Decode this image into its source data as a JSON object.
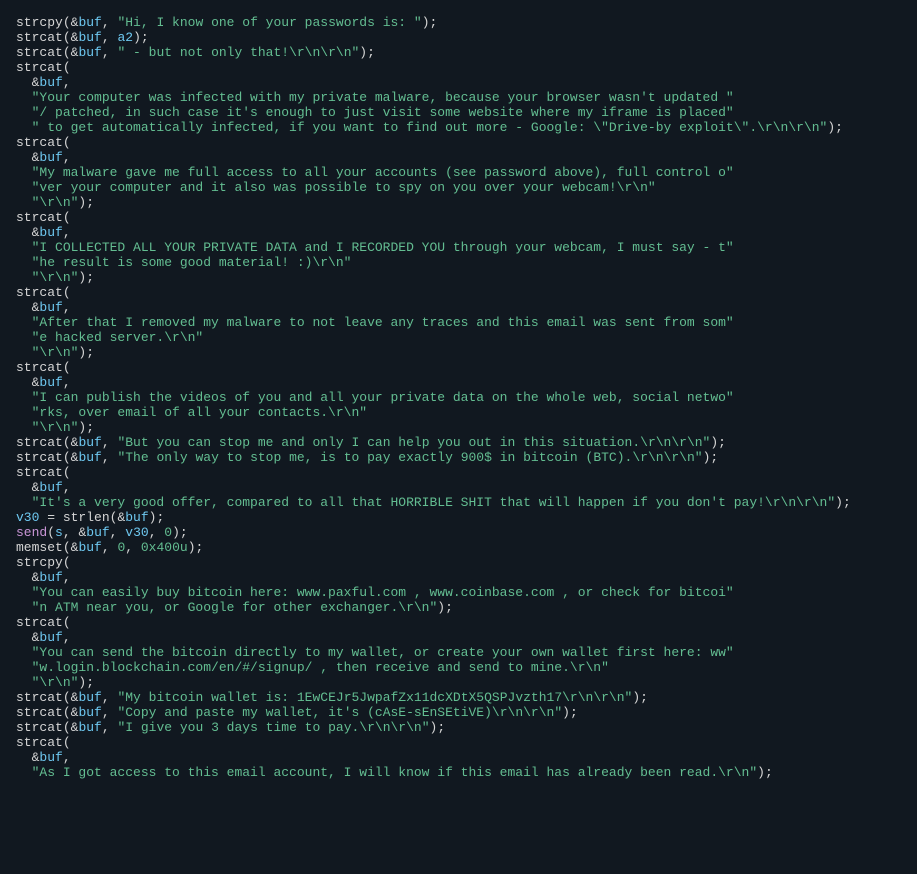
{
  "colors": {
    "background": "#111820",
    "default": "#d5d5d5",
    "variable": "#6ec8f0",
    "string": "#63bd91",
    "number": "#63bd91",
    "keyword": "#c995d6"
  },
  "code": {
    "lines": [
      [
        {
          "t": "fn",
          "v": "strcpy"
        },
        {
          "t": "op",
          "v": "("
        },
        {
          "t": "amp",
          "v": "&"
        },
        {
          "t": "var",
          "v": "buf"
        },
        {
          "t": "op",
          "v": ", "
        },
        {
          "t": "str",
          "v": "\"Hi, I know one of your passwords is: \""
        },
        {
          "t": "op",
          "v": ");"
        }
      ],
      [
        {
          "t": "fn",
          "v": "strcat"
        },
        {
          "t": "op",
          "v": "("
        },
        {
          "t": "amp",
          "v": "&"
        },
        {
          "t": "var",
          "v": "buf"
        },
        {
          "t": "op",
          "v": ", "
        },
        {
          "t": "var",
          "v": "a2"
        },
        {
          "t": "op",
          "v": ");"
        }
      ],
      [
        {
          "t": "fn",
          "v": "strcat"
        },
        {
          "t": "op",
          "v": "("
        },
        {
          "t": "amp",
          "v": "&"
        },
        {
          "t": "var",
          "v": "buf"
        },
        {
          "t": "op",
          "v": ", "
        },
        {
          "t": "str",
          "v": "\" - but not only that!\\r\\n\\r\\n\""
        },
        {
          "t": "op",
          "v": ");"
        }
      ],
      [
        {
          "t": "fn",
          "v": "strcat"
        },
        {
          "t": "op",
          "v": "("
        }
      ],
      [
        {
          "t": "pad",
          "v": "  "
        },
        {
          "t": "amp",
          "v": "&"
        },
        {
          "t": "var",
          "v": "buf"
        },
        {
          "t": "op",
          "v": ","
        }
      ],
      [
        {
          "t": "pad",
          "v": "  "
        },
        {
          "t": "str",
          "v": "\"Your computer was infected with my private malware, because your browser wasn't updated \""
        }
      ],
      [
        {
          "t": "pad",
          "v": "  "
        },
        {
          "t": "str",
          "v": "\"/ patched, in such case it's enough to just visit some website where my iframe is placed\""
        }
      ],
      [
        {
          "t": "pad",
          "v": "  "
        },
        {
          "t": "str",
          "v": "\" to get automatically infected, if you want to find out more - Google: \\\"Drive-by exploit\\\".\\r\\n\\r\\n\""
        },
        {
          "t": "op",
          "v": ");"
        }
      ],
      [
        {
          "t": "fn",
          "v": "strcat"
        },
        {
          "t": "op",
          "v": "("
        }
      ],
      [
        {
          "t": "pad",
          "v": "  "
        },
        {
          "t": "amp",
          "v": "&"
        },
        {
          "t": "var",
          "v": "buf"
        },
        {
          "t": "op",
          "v": ","
        }
      ],
      [
        {
          "t": "pad",
          "v": "  "
        },
        {
          "t": "str",
          "v": "\"My malware gave me full access to all your accounts (see password above), full control o\""
        }
      ],
      [
        {
          "t": "pad",
          "v": "  "
        },
        {
          "t": "str",
          "v": "\"ver your computer and it also was possible to spy on you over your webcam!\\r\\n\""
        }
      ],
      [
        {
          "t": "pad",
          "v": "  "
        },
        {
          "t": "str",
          "v": "\"\\r\\n\""
        },
        {
          "t": "op",
          "v": ");"
        }
      ],
      [
        {
          "t": "fn",
          "v": "strcat"
        },
        {
          "t": "op",
          "v": "("
        }
      ],
      [
        {
          "t": "pad",
          "v": "  "
        },
        {
          "t": "amp",
          "v": "&"
        },
        {
          "t": "var",
          "v": "buf"
        },
        {
          "t": "op",
          "v": ","
        }
      ],
      [
        {
          "t": "pad",
          "v": "  "
        },
        {
          "t": "str",
          "v": "\"I COLLECTED ALL YOUR PRIVATE DATA and I RECORDED YOU through your webcam, I must say - t\""
        }
      ],
      [
        {
          "t": "pad",
          "v": "  "
        },
        {
          "t": "str",
          "v": "\"he result is some good material! :)\\r\\n\""
        }
      ],
      [
        {
          "t": "pad",
          "v": "  "
        },
        {
          "t": "str",
          "v": "\"\\r\\n\""
        },
        {
          "t": "op",
          "v": ");"
        }
      ],
      [
        {
          "t": "fn",
          "v": "strcat"
        },
        {
          "t": "op",
          "v": "("
        }
      ],
      [
        {
          "t": "pad",
          "v": "  "
        },
        {
          "t": "amp",
          "v": "&"
        },
        {
          "t": "var",
          "v": "buf"
        },
        {
          "t": "op",
          "v": ","
        }
      ],
      [
        {
          "t": "pad",
          "v": "  "
        },
        {
          "t": "str",
          "v": "\"After that I removed my malware to not leave any traces and this email was sent from som\""
        }
      ],
      [
        {
          "t": "pad",
          "v": "  "
        },
        {
          "t": "str",
          "v": "\"e hacked server.\\r\\n\""
        }
      ],
      [
        {
          "t": "pad",
          "v": "  "
        },
        {
          "t": "str",
          "v": "\"\\r\\n\""
        },
        {
          "t": "op",
          "v": ");"
        }
      ],
      [
        {
          "t": "fn",
          "v": "strcat"
        },
        {
          "t": "op",
          "v": "("
        }
      ],
      [
        {
          "t": "pad",
          "v": "  "
        },
        {
          "t": "amp",
          "v": "&"
        },
        {
          "t": "var",
          "v": "buf"
        },
        {
          "t": "op",
          "v": ","
        }
      ],
      [
        {
          "t": "pad",
          "v": "  "
        },
        {
          "t": "str",
          "v": "\"I can publish the videos of you and all your private data on the whole web, social netwo\""
        }
      ],
      [
        {
          "t": "pad",
          "v": "  "
        },
        {
          "t": "str",
          "v": "\"rks, over email of all your contacts.\\r\\n\""
        }
      ],
      [
        {
          "t": "pad",
          "v": "  "
        },
        {
          "t": "str",
          "v": "\"\\r\\n\""
        },
        {
          "t": "op",
          "v": ");"
        }
      ],
      [
        {
          "t": "fn",
          "v": "strcat"
        },
        {
          "t": "op",
          "v": "("
        },
        {
          "t": "amp",
          "v": "&"
        },
        {
          "t": "var",
          "v": "buf"
        },
        {
          "t": "op",
          "v": ", "
        },
        {
          "t": "str",
          "v": "\"But you can stop me and only I can help you out in this situation.\\r\\n\\r\\n\""
        },
        {
          "t": "op",
          "v": ");"
        }
      ],
      [
        {
          "t": "fn",
          "v": "strcat"
        },
        {
          "t": "op",
          "v": "("
        },
        {
          "t": "amp",
          "v": "&"
        },
        {
          "t": "var",
          "v": "buf"
        },
        {
          "t": "op",
          "v": ", "
        },
        {
          "t": "str",
          "v": "\"The only way to stop me, is to pay exactly 900$ in bitcoin (BTC).\\r\\n\\r\\n\""
        },
        {
          "t": "op",
          "v": ");"
        }
      ],
      [
        {
          "t": "fn",
          "v": "strcat"
        },
        {
          "t": "op",
          "v": "("
        }
      ],
      [
        {
          "t": "pad",
          "v": "  "
        },
        {
          "t": "amp",
          "v": "&"
        },
        {
          "t": "var",
          "v": "buf"
        },
        {
          "t": "op",
          "v": ","
        }
      ],
      [
        {
          "t": "pad",
          "v": "  "
        },
        {
          "t": "str",
          "v": "\"It's a very good offer, compared to all that HORRIBLE SHIT that will happen if you don't pay!\\r\\n\\r\\n\""
        },
        {
          "t": "op",
          "v": ");"
        }
      ],
      [
        {
          "t": "var",
          "v": "v30"
        },
        {
          "t": "op",
          "v": " = "
        },
        {
          "t": "fn",
          "v": "strlen"
        },
        {
          "t": "op",
          "v": "("
        },
        {
          "t": "amp",
          "v": "&"
        },
        {
          "t": "var",
          "v": "buf"
        },
        {
          "t": "op",
          "v": ");"
        }
      ],
      [
        {
          "t": "kw",
          "v": "send"
        },
        {
          "t": "op",
          "v": "("
        },
        {
          "t": "var",
          "v": "s"
        },
        {
          "t": "op",
          "v": ", "
        },
        {
          "t": "amp",
          "v": "&"
        },
        {
          "t": "var",
          "v": "buf"
        },
        {
          "t": "op",
          "v": ", "
        },
        {
          "t": "var",
          "v": "v30"
        },
        {
          "t": "op",
          "v": ", "
        },
        {
          "t": "num",
          "v": "0"
        },
        {
          "t": "op",
          "v": ");"
        }
      ],
      [
        {
          "t": "fn",
          "v": "memset"
        },
        {
          "t": "op",
          "v": "("
        },
        {
          "t": "amp",
          "v": "&"
        },
        {
          "t": "var",
          "v": "buf"
        },
        {
          "t": "op",
          "v": ", "
        },
        {
          "t": "num",
          "v": "0"
        },
        {
          "t": "op",
          "v": ", "
        },
        {
          "t": "num",
          "v": "0x400u"
        },
        {
          "t": "op",
          "v": ");"
        }
      ],
      [
        {
          "t": "fn",
          "v": "strcpy"
        },
        {
          "t": "op",
          "v": "("
        }
      ],
      [
        {
          "t": "pad",
          "v": "  "
        },
        {
          "t": "amp",
          "v": "&"
        },
        {
          "t": "var",
          "v": "buf"
        },
        {
          "t": "op",
          "v": ","
        }
      ],
      [
        {
          "t": "pad",
          "v": "  "
        },
        {
          "t": "str",
          "v": "\"You can easily buy bitcoin here: www.paxful.com , www.coinbase.com , or check for bitcoi\""
        }
      ],
      [
        {
          "t": "pad",
          "v": "  "
        },
        {
          "t": "str",
          "v": "\"n ATM near you, or Google for other exchanger.\\r\\n\""
        },
        {
          "t": "op",
          "v": ");"
        }
      ],
      [
        {
          "t": "fn",
          "v": "strcat"
        },
        {
          "t": "op",
          "v": "("
        }
      ],
      [
        {
          "t": "pad",
          "v": "  "
        },
        {
          "t": "amp",
          "v": "&"
        },
        {
          "t": "var",
          "v": "buf"
        },
        {
          "t": "op",
          "v": ","
        }
      ],
      [
        {
          "t": "pad",
          "v": "  "
        },
        {
          "t": "str",
          "v": "\"You can send the bitcoin directly to my wallet, or create your own wallet first here: ww\""
        }
      ],
      [
        {
          "t": "pad",
          "v": "  "
        },
        {
          "t": "str",
          "v": "\"w.login.blockchain.com/en/#/signup/ , then receive and send to mine.\\r\\n\""
        }
      ],
      [
        {
          "t": "pad",
          "v": "  "
        },
        {
          "t": "str",
          "v": "\"\\r\\n\""
        },
        {
          "t": "op",
          "v": ");"
        }
      ],
      [
        {
          "t": "fn",
          "v": "strcat"
        },
        {
          "t": "op",
          "v": "("
        },
        {
          "t": "amp",
          "v": "&"
        },
        {
          "t": "var",
          "v": "buf"
        },
        {
          "t": "op",
          "v": ", "
        },
        {
          "t": "str",
          "v": "\"My bitcoin wallet is: 1EwCEJr5JwpafZx11dcXDtX5QSPJvzth17\\r\\n\\r\\n\""
        },
        {
          "t": "op",
          "v": ");"
        }
      ],
      [
        {
          "t": "fn",
          "v": "strcat"
        },
        {
          "t": "op",
          "v": "("
        },
        {
          "t": "amp",
          "v": "&"
        },
        {
          "t": "var",
          "v": "buf"
        },
        {
          "t": "op",
          "v": ", "
        },
        {
          "t": "str",
          "v": "\"Copy and paste my wallet, it's (cAsE-sEnSEtiVE)\\r\\n\\r\\n\""
        },
        {
          "t": "op",
          "v": ");"
        }
      ],
      [
        {
          "t": "fn",
          "v": "strcat"
        },
        {
          "t": "op",
          "v": "("
        },
        {
          "t": "amp",
          "v": "&"
        },
        {
          "t": "var",
          "v": "buf"
        },
        {
          "t": "op",
          "v": ", "
        },
        {
          "t": "str",
          "v": "\"I give you 3 days time to pay.\\r\\n\\r\\n\""
        },
        {
          "t": "op",
          "v": ");"
        }
      ],
      [
        {
          "t": "fn",
          "v": "strcat"
        },
        {
          "t": "op",
          "v": "("
        }
      ],
      [
        {
          "t": "pad",
          "v": "  "
        },
        {
          "t": "amp",
          "v": "&"
        },
        {
          "t": "var",
          "v": "buf"
        },
        {
          "t": "op",
          "v": ","
        }
      ],
      [
        {
          "t": "pad",
          "v": "  "
        },
        {
          "t": "str",
          "v": "\"As I got access to this email account, I will know if this email has already been read.\\r\\n\""
        },
        {
          "t": "op",
          "v": ");"
        }
      ]
    ]
  }
}
